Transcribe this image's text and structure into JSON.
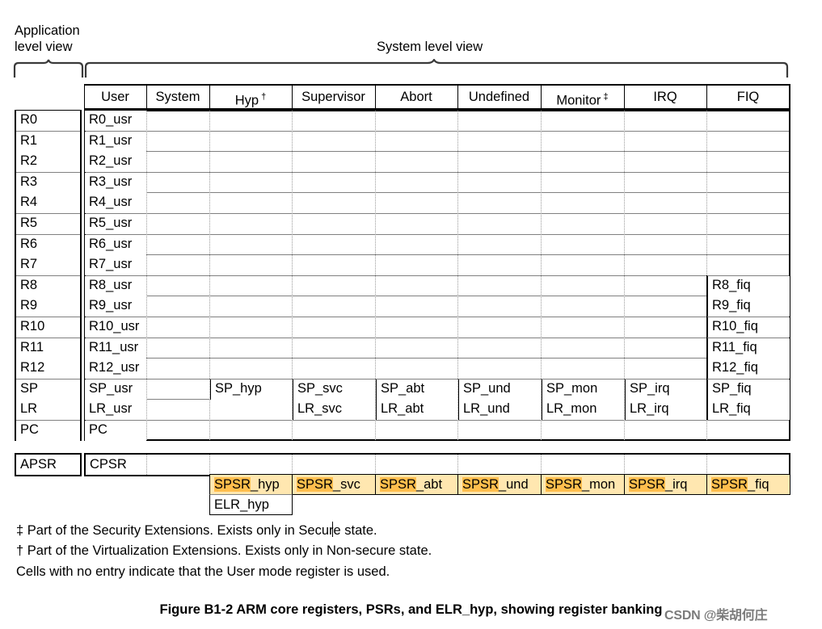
{
  "figure": {
    "caption": "Figure B1-2 ARM core registers, PSRs, and ELR_hyp, showing register banking",
    "watermark": "CSDN @柴胡何庄"
  },
  "braces": {
    "application_label": "Application\nlevel view",
    "system_label": "System level view"
  },
  "columns": [
    {
      "label": "User",
      "marker": ""
    },
    {
      "label": "System",
      "marker": ""
    },
    {
      "label": "Hyp",
      "marker": "†"
    },
    {
      "label": "Supervisor",
      "marker": ""
    },
    {
      "label": "Abort",
      "marker": ""
    },
    {
      "label": "Undefined",
      "marker": ""
    },
    {
      "label": "Monitor",
      "marker": "‡"
    },
    {
      "label": "IRQ",
      "marker": ""
    },
    {
      "label": "FIQ",
      "marker": ""
    }
  ],
  "app_column": {
    "registers": [
      "R0",
      "R1",
      "R2",
      "R3",
      "R4",
      "R5",
      "R6",
      "R7",
      "R8",
      "R9",
      "R10",
      "R11",
      "R12",
      "SP",
      "LR",
      "PC"
    ],
    "psr": "APSR"
  },
  "rows": [
    {
      "app": "R0",
      "user": "R0_usr",
      "system": "",
      "hyp": "",
      "supervisor": "",
      "abort": "",
      "undefined": "",
      "monitor": "",
      "irq": "",
      "fiq": ""
    },
    {
      "app": "R1",
      "user": "R1_usr",
      "system": "",
      "hyp": "",
      "supervisor": "",
      "abort": "",
      "undefined": "",
      "monitor": "",
      "irq": "",
      "fiq": ""
    },
    {
      "app": "R2",
      "user": "R2_usr",
      "system": "",
      "hyp": "",
      "supervisor": "",
      "abort": "",
      "undefined": "",
      "monitor": "",
      "irq": "",
      "fiq": ""
    },
    {
      "app": "R3",
      "user": "R3_usr",
      "system": "",
      "hyp": "",
      "supervisor": "",
      "abort": "",
      "undefined": "",
      "monitor": "",
      "irq": "",
      "fiq": ""
    },
    {
      "app": "R4",
      "user": "R4_usr",
      "system": "",
      "hyp": "",
      "supervisor": "",
      "abort": "",
      "undefined": "",
      "monitor": "",
      "irq": "",
      "fiq": ""
    },
    {
      "app": "R5",
      "user": "R5_usr",
      "system": "",
      "hyp": "",
      "supervisor": "",
      "abort": "",
      "undefined": "",
      "monitor": "",
      "irq": "",
      "fiq": ""
    },
    {
      "app": "R6",
      "user": "R6_usr",
      "system": "",
      "hyp": "",
      "supervisor": "",
      "abort": "",
      "undefined": "",
      "monitor": "",
      "irq": "",
      "fiq": ""
    },
    {
      "app": "R7",
      "user": "R7_usr",
      "system": "",
      "hyp": "",
      "supervisor": "",
      "abort": "",
      "undefined": "",
      "monitor": "",
      "irq": "",
      "fiq": ""
    },
    {
      "app": "R8",
      "user": "R8_usr",
      "system": "",
      "hyp": "",
      "supervisor": "",
      "abort": "",
      "undefined": "",
      "monitor": "",
      "irq": "",
      "fiq": "R8_fiq"
    },
    {
      "app": "R9",
      "user": "R9_usr",
      "system": "",
      "hyp": "",
      "supervisor": "",
      "abort": "",
      "undefined": "",
      "monitor": "",
      "irq": "",
      "fiq": "R9_fiq"
    },
    {
      "app": "R10",
      "user": "R10_usr",
      "system": "",
      "hyp": "",
      "supervisor": "",
      "abort": "",
      "undefined": "",
      "monitor": "",
      "irq": "",
      "fiq": "R10_fiq"
    },
    {
      "app": "R11",
      "user": "R11_usr",
      "system": "",
      "hyp": "",
      "supervisor": "",
      "abort": "",
      "undefined": "",
      "monitor": "",
      "irq": "",
      "fiq": "R11_fiq"
    },
    {
      "app": "R12",
      "user": "R12_usr",
      "system": "",
      "hyp": "",
      "supervisor": "",
      "abort": "",
      "undefined": "",
      "monitor": "",
      "irq": "",
      "fiq": "R12_fiq"
    },
    {
      "app": "SP",
      "user": "SP_usr",
      "system": "",
      "hyp": "SP_hyp",
      "supervisor": "SP_svc",
      "abort": "SP_abt",
      "undefined": "SP_und",
      "monitor": "SP_mon",
      "irq": "SP_irq",
      "fiq": "SP_fiq"
    },
    {
      "app": "LR",
      "user": "LR_usr",
      "system": "",
      "hyp": "",
      "supervisor": "LR_svc",
      "abort": "LR_abt",
      "undefined": "LR_und",
      "monitor": "LR_mon",
      "irq": "LR_irq",
      "fiq": "LR_fiq"
    },
    {
      "app": "PC",
      "user": "PC",
      "system": "",
      "hyp": "",
      "supervisor": "",
      "abort": "",
      "undefined": "",
      "monitor": "",
      "irq": "",
      "fiq": ""
    }
  ],
  "psr_row": {
    "app": "APSR",
    "user": "CPSR"
  },
  "spsr_row": {
    "highlight_prefix": "SPSR",
    "cells": [
      {
        "column": "hyp",
        "prefix": "SPSR",
        "suffix": "_hyp"
      },
      {
        "column": "supervisor",
        "prefix": "SPSR",
        "suffix": "_svc"
      },
      {
        "column": "abort",
        "prefix": "SPSR",
        "suffix": "_abt"
      },
      {
        "column": "undefined",
        "prefix": "SPSR",
        "suffix": "_und"
      },
      {
        "column": "monitor",
        "prefix": "SPSR",
        "suffix": "_mon"
      },
      {
        "column": "irq",
        "prefix": "SPSR",
        "suffix": "_irq"
      },
      {
        "column": "fiq",
        "prefix": "SPSR",
        "suffix": "_fiq"
      }
    ]
  },
  "elr_row": {
    "column": "hyp",
    "label": "ELR_hyp"
  },
  "footnotes": [
    "‡ Part of the Security Extensions. Exists only in Secure state.",
    "† Part of the Virtualization Extensions. Exists only in Non-secure state.",
    "Cells with no entry indicate that the User mode register is used."
  ],
  "colors": {
    "spsr_cell_background": "#ffe7b0",
    "spsr_text_highlight": "#ffbe4d",
    "grid_line": "#808080",
    "border": "#000000",
    "page_background": "#ffffff"
  }
}
